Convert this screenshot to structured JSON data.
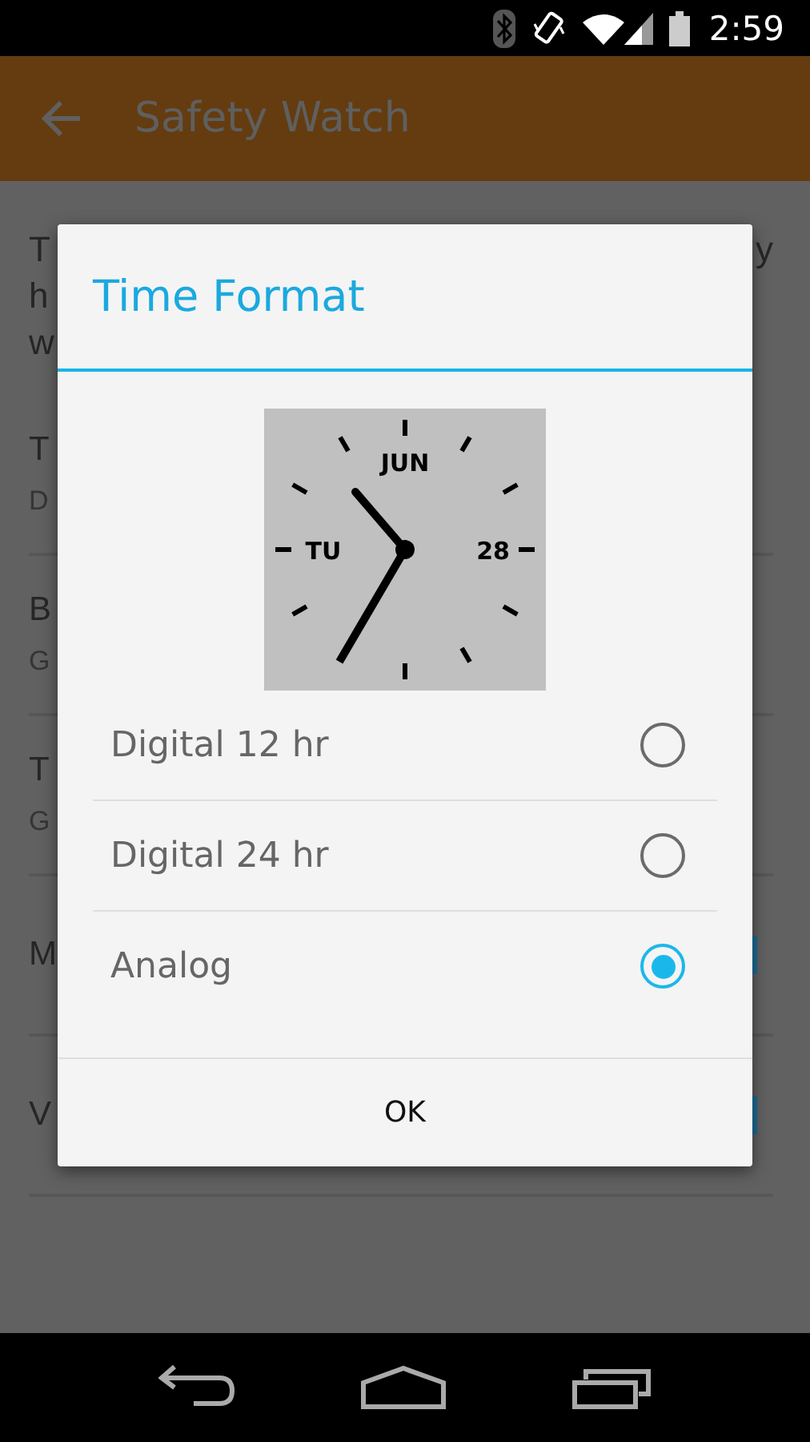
{
  "status_bar": {
    "time": "2:59"
  },
  "app_bar": {
    "title": "Safety Watch"
  },
  "background": {
    "intro_lines": [
      {
        "left": "T",
        "right": "y"
      },
      {
        "left": "h"
      },
      {
        "left": "w"
      }
    ],
    "rows": [
      {
        "title": "T",
        "subtitle": "D"
      },
      {
        "title": "B",
        "subtitle": "G"
      },
      {
        "title": "T",
        "subtitle": "G"
      },
      {
        "title": "M",
        "kind": "checkbox",
        "checked": true
      },
      {
        "title": "V",
        "kind": "checkbox",
        "checked": true
      }
    ]
  },
  "dialog": {
    "title": "Time Format",
    "clock_preview": {
      "month": "JUN",
      "weekday": "TU",
      "day": "28"
    },
    "options": [
      {
        "label": "Digital 12 hr",
        "selected": false
      },
      {
        "label": "Digital 24 hr",
        "selected": false
      },
      {
        "label": "Analog",
        "selected": true
      }
    ],
    "button": "OK"
  }
}
